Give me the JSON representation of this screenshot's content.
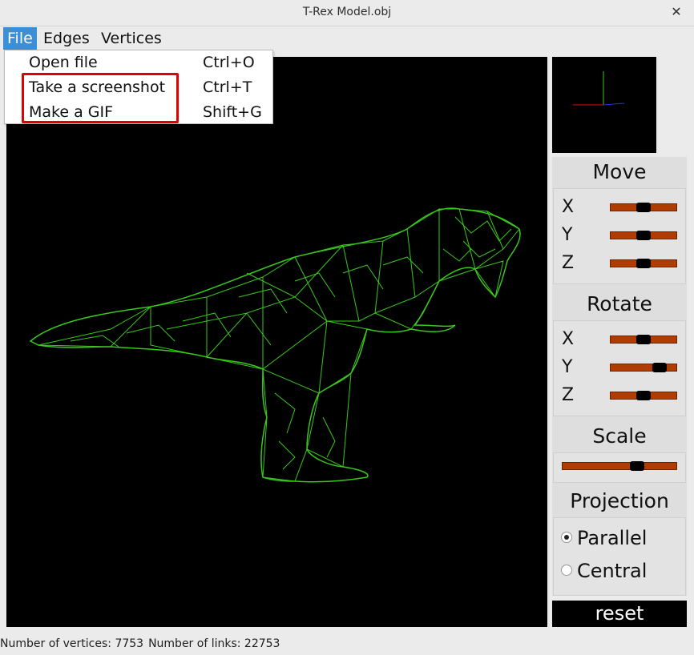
{
  "window": {
    "title": "T-Rex Model.obj",
    "close_glyph": "✕"
  },
  "menubar": {
    "items": [
      "File",
      "Edges",
      "Vertices"
    ]
  },
  "file_menu": {
    "items": [
      {
        "label": "Open file",
        "shortcut": "Ctrl+O"
      },
      {
        "label": "Take a screenshot",
        "shortcut": "Ctrl+T"
      },
      {
        "label": "Make a GIF",
        "shortcut": "Shift+G"
      }
    ]
  },
  "controls": {
    "move": {
      "title": "Move",
      "sliders": [
        {
          "label": "X",
          "value": 0.5
        },
        {
          "label": "Y",
          "value": 0.5
        },
        {
          "label": "Z",
          "value": 0.5
        }
      ]
    },
    "rotate": {
      "title": "Rotate",
      "sliders": [
        {
          "label": "X",
          "value": 0.5
        },
        {
          "label": "Y",
          "value": 0.82
        },
        {
          "label": "Z",
          "value": 0.5
        }
      ]
    },
    "scale": {
      "title": "Scale",
      "value": 0.68
    },
    "projection": {
      "title": "Projection",
      "options": [
        {
          "label": "Parallel",
          "checked": true
        },
        {
          "label": "Central",
          "checked": false
        }
      ]
    },
    "reset_label": "reset"
  },
  "status": {
    "vertices_text": "Number of vertices: 7753",
    "links_text": "Number of links: 22753"
  },
  "colors": {
    "model": "#39c81c",
    "highlight": "#e00000",
    "slider_track": "#b03c00",
    "menu_active": "#3a8fd6"
  }
}
